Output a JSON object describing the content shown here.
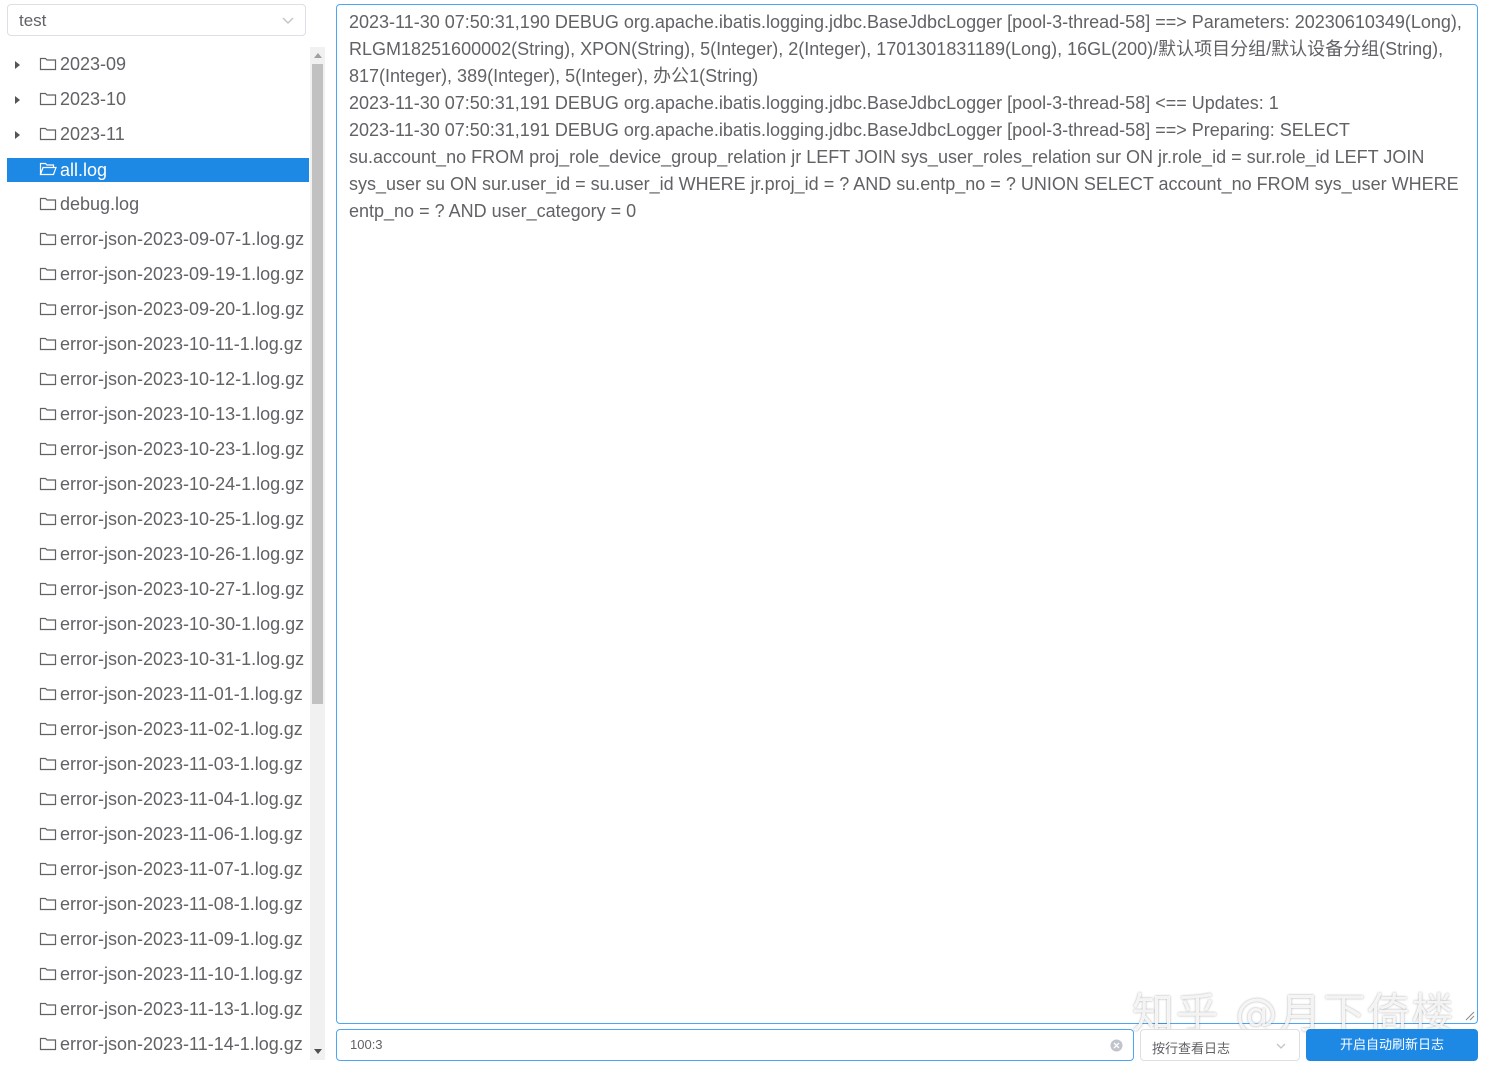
{
  "file_select": {
    "value": "test"
  },
  "tree": {
    "items": [
      {
        "label": "2023-09",
        "expandable": true,
        "selected": false,
        "icon": "folder-icon"
      },
      {
        "label": "2023-10",
        "expandable": true,
        "selected": false,
        "icon": "folder-icon"
      },
      {
        "label": "2023-11",
        "expandable": true,
        "selected": false,
        "icon": "folder-icon"
      },
      {
        "label": "all.log",
        "expandable": false,
        "selected": true,
        "icon": "folder-open-icon"
      },
      {
        "label": "debug.log",
        "expandable": false,
        "selected": false,
        "icon": "folder-icon"
      },
      {
        "label": "error-json-2023-09-07-1.log.gz",
        "expandable": false,
        "selected": false,
        "icon": "folder-icon"
      },
      {
        "label": "error-json-2023-09-19-1.log.gz",
        "expandable": false,
        "selected": false,
        "icon": "folder-icon"
      },
      {
        "label": "error-json-2023-09-20-1.log.gz",
        "expandable": false,
        "selected": false,
        "icon": "folder-icon"
      },
      {
        "label": "error-json-2023-10-11-1.log.gz",
        "expandable": false,
        "selected": false,
        "icon": "folder-icon"
      },
      {
        "label": "error-json-2023-10-12-1.log.gz",
        "expandable": false,
        "selected": false,
        "icon": "folder-icon"
      },
      {
        "label": "error-json-2023-10-13-1.log.gz",
        "expandable": false,
        "selected": false,
        "icon": "folder-icon"
      },
      {
        "label": "error-json-2023-10-23-1.log.gz",
        "expandable": false,
        "selected": false,
        "icon": "folder-icon"
      },
      {
        "label": "error-json-2023-10-24-1.log.gz",
        "expandable": false,
        "selected": false,
        "icon": "folder-icon"
      },
      {
        "label": "error-json-2023-10-25-1.log.gz",
        "expandable": false,
        "selected": false,
        "icon": "folder-icon"
      },
      {
        "label": "error-json-2023-10-26-1.log.gz",
        "expandable": false,
        "selected": false,
        "icon": "folder-icon"
      },
      {
        "label": "error-json-2023-10-27-1.log.gz",
        "expandable": false,
        "selected": false,
        "icon": "folder-icon"
      },
      {
        "label": "error-json-2023-10-30-1.log.gz",
        "expandable": false,
        "selected": false,
        "icon": "folder-icon"
      },
      {
        "label": "error-json-2023-10-31-1.log.gz",
        "expandable": false,
        "selected": false,
        "icon": "folder-icon"
      },
      {
        "label": "error-json-2023-11-01-1.log.gz",
        "expandable": false,
        "selected": false,
        "icon": "folder-icon"
      },
      {
        "label": "error-json-2023-11-02-1.log.gz",
        "expandable": false,
        "selected": false,
        "icon": "folder-icon"
      },
      {
        "label": "error-json-2023-11-03-1.log.gz",
        "expandable": false,
        "selected": false,
        "icon": "folder-icon"
      },
      {
        "label": "error-json-2023-11-04-1.log.gz",
        "expandable": false,
        "selected": false,
        "icon": "folder-icon"
      },
      {
        "label": "error-json-2023-11-06-1.log.gz",
        "expandable": false,
        "selected": false,
        "icon": "folder-icon"
      },
      {
        "label": "error-json-2023-11-07-1.log.gz",
        "expandable": false,
        "selected": false,
        "icon": "folder-icon"
      },
      {
        "label": "error-json-2023-11-08-1.log.gz",
        "expandable": false,
        "selected": false,
        "icon": "folder-icon"
      },
      {
        "label": "error-json-2023-11-09-1.log.gz",
        "expandable": false,
        "selected": false,
        "icon": "folder-icon"
      },
      {
        "label": "error-json-2023-11-10-1.log.gz",
        "expandable": false,
        "selected": false,
        "icon": "folder-icon"
      },
      {
        "label": "error-json-2023-11-13-1.log.gz",
        "expandable": false,
        "selected": false,
        "icon": "folder-icon"
      },
      {
        "label": "error-json-2023-11-14-1.log.gz",
        "expandable": false,
        "selected": false,
        "icon": "folder-icon"
      }
    ]
  },
  "log": {
    "lines": [
      "2023-11-30 07:50:31,190 DEBUG org.apache.ibatis.logging.jdbc.BaseJdbcLogger [pool-3-thread-58] ==> Parameters: 20230610349(Long), RLGM18251600002(String), XPON(String), 5(Integer), 2(Integer), 1701301831189(Long), 16GL(200)/默认项目分组/默认设备分组(String), 817(Integer), 389(Integer), 5(Integer), 办公1(String)",
      "2023-11-30 07:50:31,191 DEBUG org.apache.ibatis.logging.jdbc.BaseJdbcLogger [pool-3-thread-58] <==    Updates: 1",
      "2023-11-30 07:50:31,191 DEBUG org.apache.ibatis.logging.jdbc.BaseJdbcLogger [pool-3-thread-58] ==>  Preparing: SELECT su.account_no FROM proj_role_device_group_relation jr LEFT JOIN sys_user_roles_relation sur ON jr.role_id = sur.role_id LEFT JOIN sys_user su ON sur.user_id = su.user_id WHERE jr.proj_id = ? AND su.entp_no = ? UNION SELECT account_no FROM sys_user WHERE entp_no = ? AND user_category = 0"
    ]
  },
  "watermark": "知乎 @月下倚楼",
  "bottom": {
    "input_value": "100:3",
    "mode_value": "按行查看日志",
    "button_label": "开启自动刷新日志"
  },
  "colors": {
    "accent": "#1e88e5",
    "focus_border": "#4ba6f5",
    "text": "#606266"
  }
}
